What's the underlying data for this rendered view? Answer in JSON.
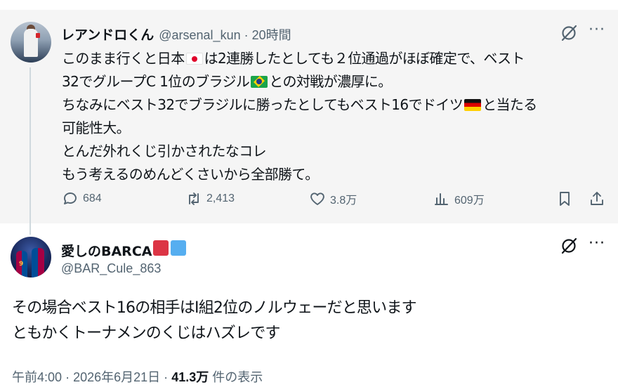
{
  "parent_tweet": {
    "display_name": "レアンドロくん",
    "handle": "@arsenal_kun",
    "separator": "·",
    "time": "20時間",
    "lines": [
      [
        "このまま行くと日本",
        "は2連勝したとしても２位通過がほぼ確定で、ベスト"
      ],
      [
        "32でグループC 1位のブラジル",
        "との対戦が濃厚に。"
      ],
      [
        "ちなみにベスト32でブラジルに勝ったとしてもベスト16でドイツ",
        "と当たる"
      ],
      [
        "可能性大。"
      ],
      [
        "とんだ外れくじ引かされたなコレ"
      ],
      [
        "もう考えるのめんどくさいから全部勝て。"
      ]
    ],
    "flags": [
      "flag-jp-icon",
      "flag-br-icon",
      "flag-de-icon"
    ],
    "stats": {
      "replies": "684",
      "reposts": "2,413",
      "likes": "3.8万",
      "views": "609万"
    }
  },
  "reply_tweet": {
    "display_name": "愛しのBARCA",
    "name_badges": [
      "#dc3545",
      "#56aef0"
    ],
    "handle": "@BAR_Cule_863",
    "lines": [
      "その場合ベスト16の相手はI組2位のノルウェーだと思います",
      "ともかくトーナメンのくじはハズレです"
    ],
    "meta": {
      "time": "午前4:00",
      "separator": "·",
      "date": "2026年6月21日",
      "views_count": "41.3万",
      "views_label": "件の表示"
    }
  },
  "colors": {
    "secondary_text": "#536471",
    "primary_text": "#0f1419",
    "parent_background": "#f5f5f5"
  },
  "icons": [
    "grok-icon",
    "more-icon",
    "reply-icon",
    "repost-icon",
    "like-icon",
    "views-icon",
    "bookmark-icon",
    "share-icon"
  ]
}
